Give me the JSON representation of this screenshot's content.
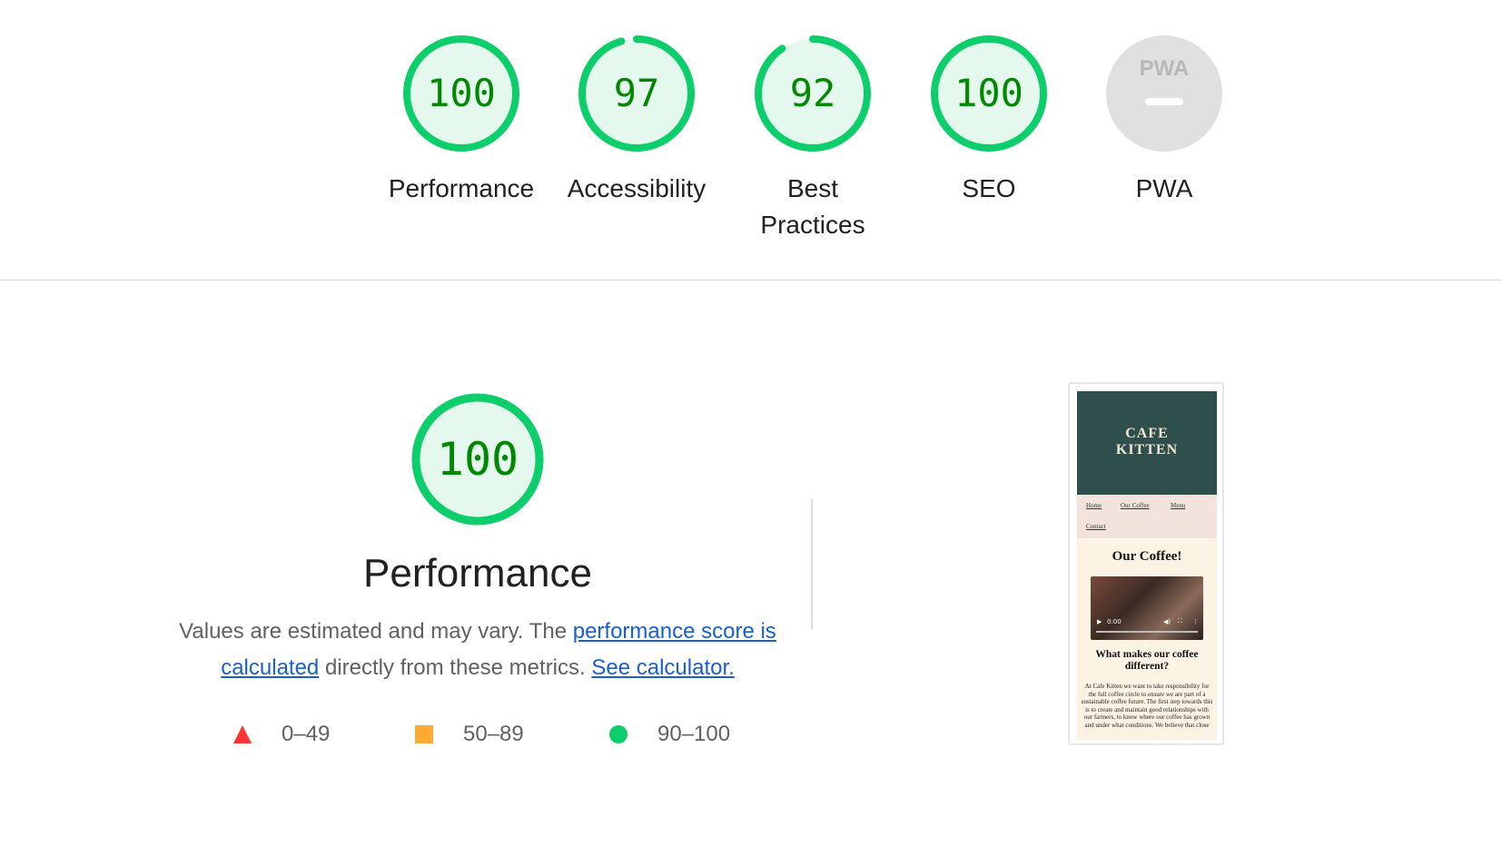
{
  "categories": [
    {
      "score": "100",
      "label": "Performance",
      "fraction": 1.0
    },
    {
      "score": "97",
      "label": "Accessibility",
      "fraction": 0.97
    },
    {
      "score": "92",
      "label": "Best Practices",
      "fraction": 0.92
    },
    {
      "score": "100",
      "label": "SEO",
      "fraction": 1.0
    }
  ],
  "pwa": {
    "label": "PWA",
    "badge_text": "PWA"
  },
  "performance": {
    "score": "100",
    "fraction": 1.0,
    "title": "Performance",
    "desc_prefix": "Values are estimated and may vary. The ",
    "link_score": "performance score is calculated",
    "desc_middle": " directly from these metrics. ",
    "link_calculator": "See calculator."
  },
  "legend": [
    {
      "range": "0–49",
      "shape": "triangle",
      "color": "#ff3333"
    },
    {
      "range": "50–89",
      "shape": "square",
      "color": "#ffaa33"
    },
    {
      "range": "90–100",
      "shape": "circle",
      "color": "#0cce6b"
    }
  ],
  "colors": {
    "pass_stroke": "#0cce6b",
    "pass_fill": "#e5f8ee",
    "pass_text": "#008800",
    "pwa_fill": "#e0e0e0",
    "link": "#1a5fd1"
  },
  "thumbnail": {
    "brand": "CAFE KITTEN",
    "nav": [
      "Home",
      "Our Coffee",
      "Menu",
      "Contact"
    ],
    "heading": "Our Coffee!",
    "video_time": "0:00",
    "subheading": "What makes our coffee different?",
    "body": "At Cafe Kitten we want to take responsibility for the full coffee circle to ensure we are part of a sustainable coffee future. The first step towards this is to create and maintain good relationships with our farmers, to know where our coffee has grown and under what conditions. We believe that close"
  }
}
